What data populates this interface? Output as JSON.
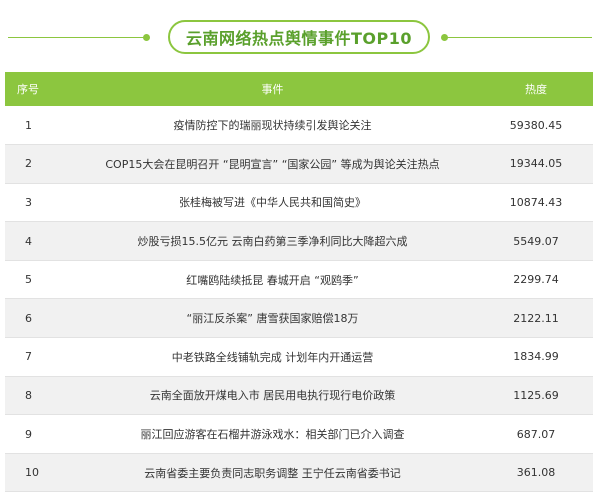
{
  "title": "云南网络热点舆情事件TOP10",
  "columns": {
    "no": "序号",
    "event": "事件",
    "heat": "热度"
  },
  "rows": [
    {
      "no": "1",
      "event": "疫情防控下的瑞丽现状持续引发舆论关注",
      "heat": "59380.45"
    },
    {
      "no": "2",
      "event": "COP15大会在昆明召开 “昆明宣言” “国家公园” 等成为舆论关注热点",
      "heat": "19344.05"
    },
    {
      "no": "3",
      "event": "张桂梅被写进《中华人民共和国简史》",
      "heat": "10874.43"
    },
    {
      "no": "4",
      "event": "炒股亏损15.5亿元 云南白药第三季净利同比大降超六成",
      "heat": "5549.07"
    },
    {
      "no": "5",
      "event": "红嘴鸥陆续抵昆 春城开启 “观鸥季”",
      "heat": "2299.74"
    },
    {
      "no": "6",
      "event": "“丽江反杀案” 唐雪获国家赔偿18万",
      "heat": "2122.11"
    },
    {
      "no": "7",
      "event": "中老铁路全线铺轨完成 计划年内开通运营",
      "heat": "1834.99"
    },
    {
      "no": "8",
      "event": "云南全面放开煤电入市 居民用电执行现行电价政策",
      "heat": "1125.69"
    },
    {
      "no": "9",
      "event": "丽江回应游客在石榴井游泳戏水：相关部门已介入调查",
      "heat": "687.07"
    },
    {
      "no": "10",
      "event": "云南省委主要负责同志职务调整 王宁任云南省委书记",
      "heat": "361.08"
    }
  ],
  "colors": {
    "accent": "#8cc63f",
    "title_text": "#5aa02c",
    "stripe": "#f1f1f1"
  }
}
